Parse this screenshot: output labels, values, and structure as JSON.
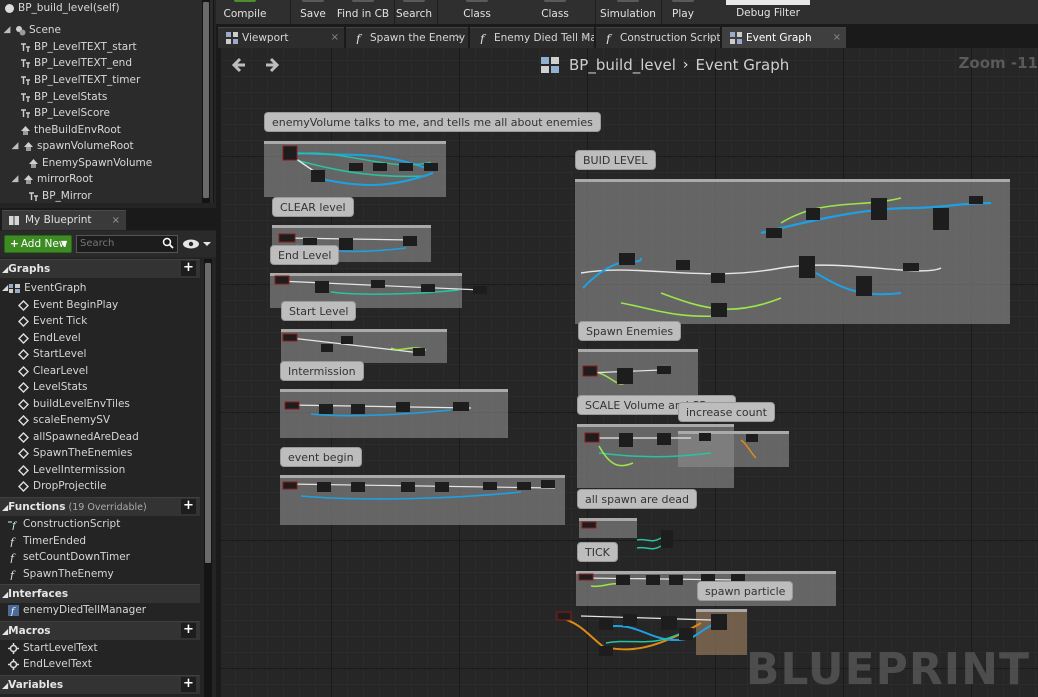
{
  "scene": {
    "root_label": "BP_build_level(self)",
    "items": [
      {
        "label": "Scene",
        "glyph": "◢"
      },
      {
        "label": "BP_LevelTEXT_start"
      },
      {
        "label": "BP_LevelTEXT_end"
      },
      {
        "label": "BP_LevelTEXT_timer"
      },
      {
        "label": "BP_LevelStats"
      },
      {
        "label": "BP_LevelScore"
      },
      {
        "label": "theBuildEnvRoot"
      },
      {
        "label": "spawnVolumeRoot",
        "glyph": "◢"
      },
      {
        "label": "EnemySpawnVolume"
      },
      {
        "label": "mirrorRoot",
        "glyph": "◢"
      },
      {
        "label": "BP_Mirror"
      }
    ]
  },
  "my_blueprint": {
    "tab_label": "My Blueprint",
    "tab_close": "×",
    "add_new_label": "Add New",
    "search_placeholder": "Search",
    "sections": {
      "graphs": {
        "label": "Graphs",
        "plus": "+"
      },
      "functions": {
        "label": "Functions",
        "sub": "(19 Overridable)",
        "plus": "+"
      },
      "interfaces": {
        "label": "Interfaces"
      },
      "macros": {
        "label": "Macros",
        "plus": "+"
      },
      "variables": {
        "label": "Variables",
        "plus": "+"
      }
    },
    "event_graph_label": "EventGraph",
    "events": [
      "Event BeginPlay",
      "Event Tick",
      "EndLevel",
      "StartLevel",
      "ClearLevel",
      "LevelStats",
      "buildLevelEnvTiles",
      "scaleEnemySV",
      "allSpawnedAreDead",
      "SpawnTheEnemies",
      "LevelIntermission",
      "DropProjectile"
    ],
    "functions": [
      "ConstructionScript",
      "TimerEnded",
      "setCountDownTimer",
      "SpawnTheEnemy"
    ],
    "interfaces": [
      "enemyDiedTellManager"
    ],
    "macros": [
      "StartLevelText",
      "EndLevelText"
    ]
  },
  "toolbar": {
    "buttons": [
      "Compile",
      "Save",
      "Find in CB",
      "Search",
      "Class Settings",
      "Class Defaults",
      "Simulation",
      "Play"
    ],
    "debug_filter": "Debug Filter"
  },
  "doc_tabs": [
    {
      "label": "Viewport",
      "icon": "viewport-icon",
      "active": false
    },
    {
      "label": "Spawn the Enemy",
      "icon": "function-icon",
      "active": false
    },
    {
      "label": "Enemy Died Tell Ma",
      "icon": "function-icon",
      "active": false
    },
    {
      "label": "Construction Script",
      "icon": "function-icon",
      "active": false
    },
    {
      "label": "Event Graph",
      "icon": "graph-icon",
      "active": true
    }
  ],
  "graph": {
    "breadcrumb_root": "BP_build_level",
    "breadcrumb_sep": "›",
    "breadcrumb_leaf": "Event Graph",
    "zoom": "Zoom -11",
    "watermark": "BLUEPRINT",
    "comments": [
      "enemyVolume talks to me, and tells me all about enemies",
      "CLEAR level",
      "End Level",
      "Start Level",
      "Intermission",
      "event begin",
      "BUID LEVEL",
      "Spawn Enemies",
      "SCALE Volume and SPawn",
      "increase count",
      "all spawn are dead",
      "TICK",
      "spawn particle"
    ]
  },
  "colors": {
    "exec_wire": "#e6e6e6",
    "object_wire": "#1da1e6",
    "bool_wire": "#8c1a1a",
    "float_wire": "#9be64a",
    "struct_wire": "#26c4a0",
    "orange_wire": "#e08a16",
    "add_new_green": "#3d8b23"
  }
}
